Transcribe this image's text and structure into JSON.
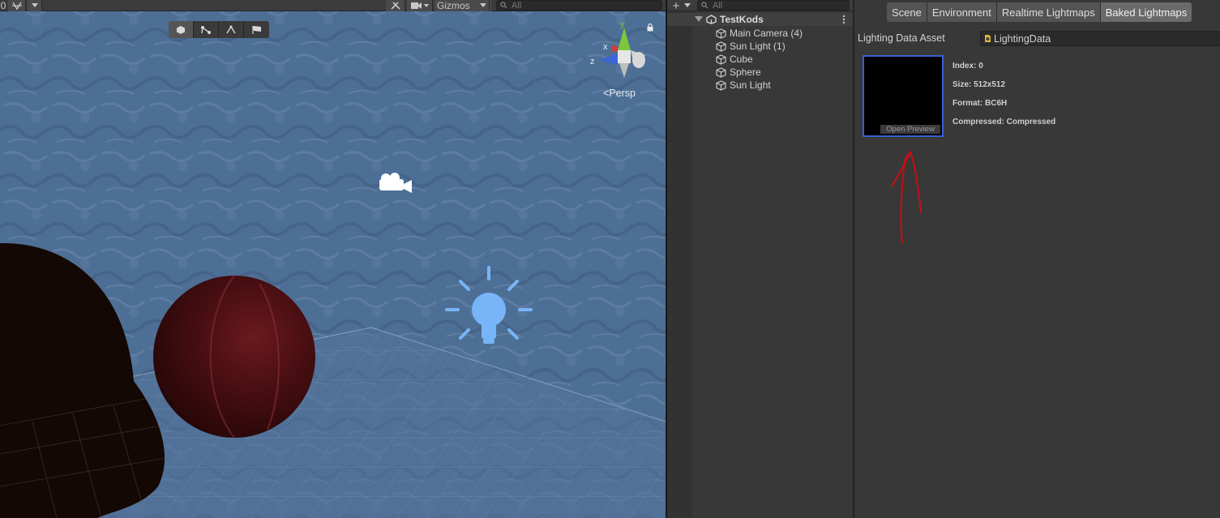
{
  "scene_view": {
    "toolbar": {
      "left_value": "0",
      "gizmos_label": "Gizmos",
      "search_placeholder": "All"
    },
    "tool_pills": [
      "cube-view-icon",
      "bone-icon",
      "path-icon",
      "flag-icon"
    ],
    "orientation_gizmo": {
      "x_label": "x",
      "y_label": "y",
      "z_label": "z",
      "projection_label": "Persp"
    }
  },
  "hierarchy": {
    "search_placeholder": "All",
    "scene_name": "TestKods",
    "items": [
      {
        "label": "Main Camera (4)"
      },
      {
        "label": "Sun Light  (1)"
      },
      {
        "label": "Cube"
      },
      {
        "label": "Sphere"
      },
      {
        "label": "Sun Light"
      }
    ]
  },
  "lighting": {
    "tabs": [
      {
        "label": "Scene",
        "active": false
      },
      {
        "label": "Environment",
        "active": false
      },
      {
        "label": "Realtime Lightmaps",
        "active": false
      },
      {
        "label": "Baked Lightmaps",
        "active": true
      }
    ],
    "lighting_data_asset_label": "Lighting Data Asset",
    "lighting_data_asset_value": "LightingData",
    "preview_button": "Open Preview",
    "info": {
      "index": "Index: 0",
      "size": "Size: 512x512",
      "format": "Format: BC6H",
      "compressed": "Compressed: Compressed"
    }
  },
  "colors": {
    "accent_selection": "#3a5fcf",
    "annotation_arrow": "#c80e14",
    "gizmo_x": "#d43a3a",
    "gizmo_y": "#7cc73c",
    "gizmo_z": "#3a64d8",
    "light_icon": "#78b4f8"
  }
}
